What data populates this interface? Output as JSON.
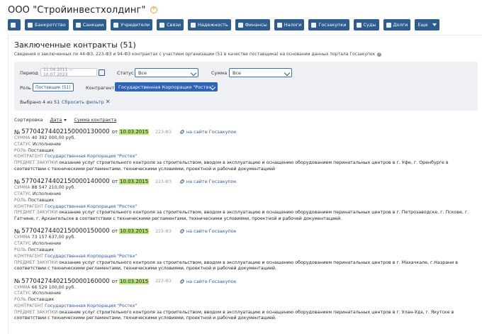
{
  "company": {
    "name": "ООО \"Стройинвестхолдинг\""
  },
  "tabs": [
    {
      "label": ""
    },
    {
      "label": "Банкротство"
    },
    {
      "label": "Санкции"
    },
    {
      "label": "Учредители"
    },
    {
      "label": "Связи"
    },
    {
      "label": "Надежность"
    },
    {
      "label": "Финансы"
    },
    {
      "label": "Налоги"
    },
    {
      "label": "Госзакупки"
    },
    {
      "label": "Суды"
    },
    {
      "label": "Долги"
    },
    {
      "label": "Еще"
    }
  ],
  "section": {
    "title": "Заключенные контракты (51)",
    "subtitle": "Сведения о заключенных по 44-ФЗ, 223-ФЗ и 94-ФЗ контрактах с участием организации (51 в качестве поставщика) на основании данных портала Госзакупок"
  },
  "filters": {
    "period_label": "Период",
    "period_value": "11.04.2011 — 10.07.2023",
    "status_label": "Статус",
    "status_value": "Все",
    "sum_label": "Сумма",
    "sum_value": "Все",
    "role_label": "Роль",
    "role_value": "Поставщик (51)",
    "counterparty_label": "Контрагент",
    "counterparty_value": "Государственная Корпорация \"Ростех\"",
    "selected_text": "Выбрано 4 из 51",
    "reset_label": "Сбросить фильтр"
  },
  "sort": {
    "label": "Сортировка",
    "date": "Дата",
    "sum": "Сумма контракта"
  },
  "labels": {
    "number_prefix": "№",
    "from": "от",
    "law": "223-ФЗ",
    "gov_link": "на сайте Госзакупок",
    "sum": "СУММА",
    "status": "СТАТУС",
    "role": "РОЛЬ",
    "counterparty": "КОНТРАГЕНТ",
    "subject": "ПРЕДМЕТ ЗАКУПКИ"
  },
  "contracts": [
    {
      "number": "57704274402150000130000",
      "date": "10.03.2015",
      "sum": "40 392 000,00 руб.",
      "status": "Исполнение",
      "role": "Поставщик",
      "counterparty": "Государственная Корпорация \"Ростех\"",
      "subject": "оказание услуг строительного контроля за строительством, вводом в эксплуатацию и оснащению оборудованием перинатальных центров в г. Уфе, г. Оренбурге в соответствии с техническими регламентами, техническими условиями, проектной и рабочей документацией"
    },
    {
      "number": "57704274402150000140000",
      "date": "10.03.2015",
      "sum": "88 547 210,00 руб.",
      "status": "Исполнение",
      "role": "Поставщик",
      "counterparty": "Государственная Корпорация \"Ростех\"",
      "subject": "оказание услуг строительного контроля за строительством, вводом в эксплуатацию и оснащению оборудованием перинатальных центров в г. Петрозаводске, г. Пскове, г. Гатчине, г. Архангельске в соответствии с техническими регламентами, техническими условиями, проектной и рабочей документацией."
    },
    {
      "number": "57704274402150000150000",
      "date": "10.03.2015",
      "sum": "73 157 637,00 руб.",
      "status": "Исполнение",
      "role": "Поставщик",
      "counterparty": "Государственная Корпорация \"Ростех\"",
      "subject": "оказание услуг строительного контроля за строительством, вводом в эксплуатацию и оснащению оборудованием перинатальных центров в г. Махачкале, г.Назрани в соответствии с техническими регламентами, техническими условиями, проектной и рабочей документацией."
    },
    {
      "number": "57704274402150000160000",
      "date": "10.03.2015",
      "sum": "66 529 100,00 руб.",
      "status": "Исполнение",
      "role": "Поставщик",
      "counterparty": "Государственная Корпорация \"Ростех\"",
      "subject": "оказание услуг строительного контроля за строительством, вводом в эксплуатацию и оснащению оборудованием перинатальных центров в г. Улан-Удэ, г. Якутске в соответствии с техническими регламентами, техническими условиями, проектной и рабочей документацией."
    }
  ]
}
